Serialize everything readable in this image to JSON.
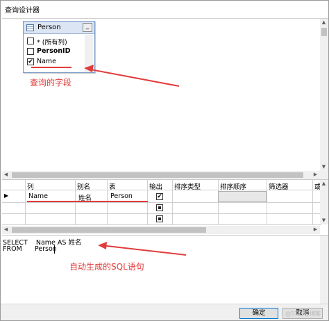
{
  "window": {
    "title": "查询设计器"
  },
  "diagram": {
    "table": {
      "name": "Person",
      "minimize_glyph": "_",
      "fields": [
        {
          "label": "* (所有列)",
          "checked": false
        },
        {
          "label": "PersonID",
          "checked": false
        },
        {
          "label": "Name",
          "checked": true
        }
      ]
    },
    "annotation": "查询的字段"
  },
  "grid": {
    "headers": [
      "列",
      "别名",
      "表",
      "输出",
      "排序类型",
      "排序顺序",
      "筛选器",
      "或"
    ],
    "rows": [
      {
        "column": "Name",
        "alias": "姓名",
        "table": "Person",
        "output": "checked"
      }
    ]
  },
  "sql": {
    "line1": "SELECT    Name AS 姓名",
    "line2": "FROM      Person",
    "annotation": "自动生成的SQL语句"
  },
  "buttons": {
    "ok": "确定",
    "cancel": "取消"
  },
  "watermark": "@51CTO博客",
  "colors": {
    "annotation": "#e23b3b",
    "table_header": "#dbe5f3",
    "primary_button_border": "#0078d7"
  }
}
